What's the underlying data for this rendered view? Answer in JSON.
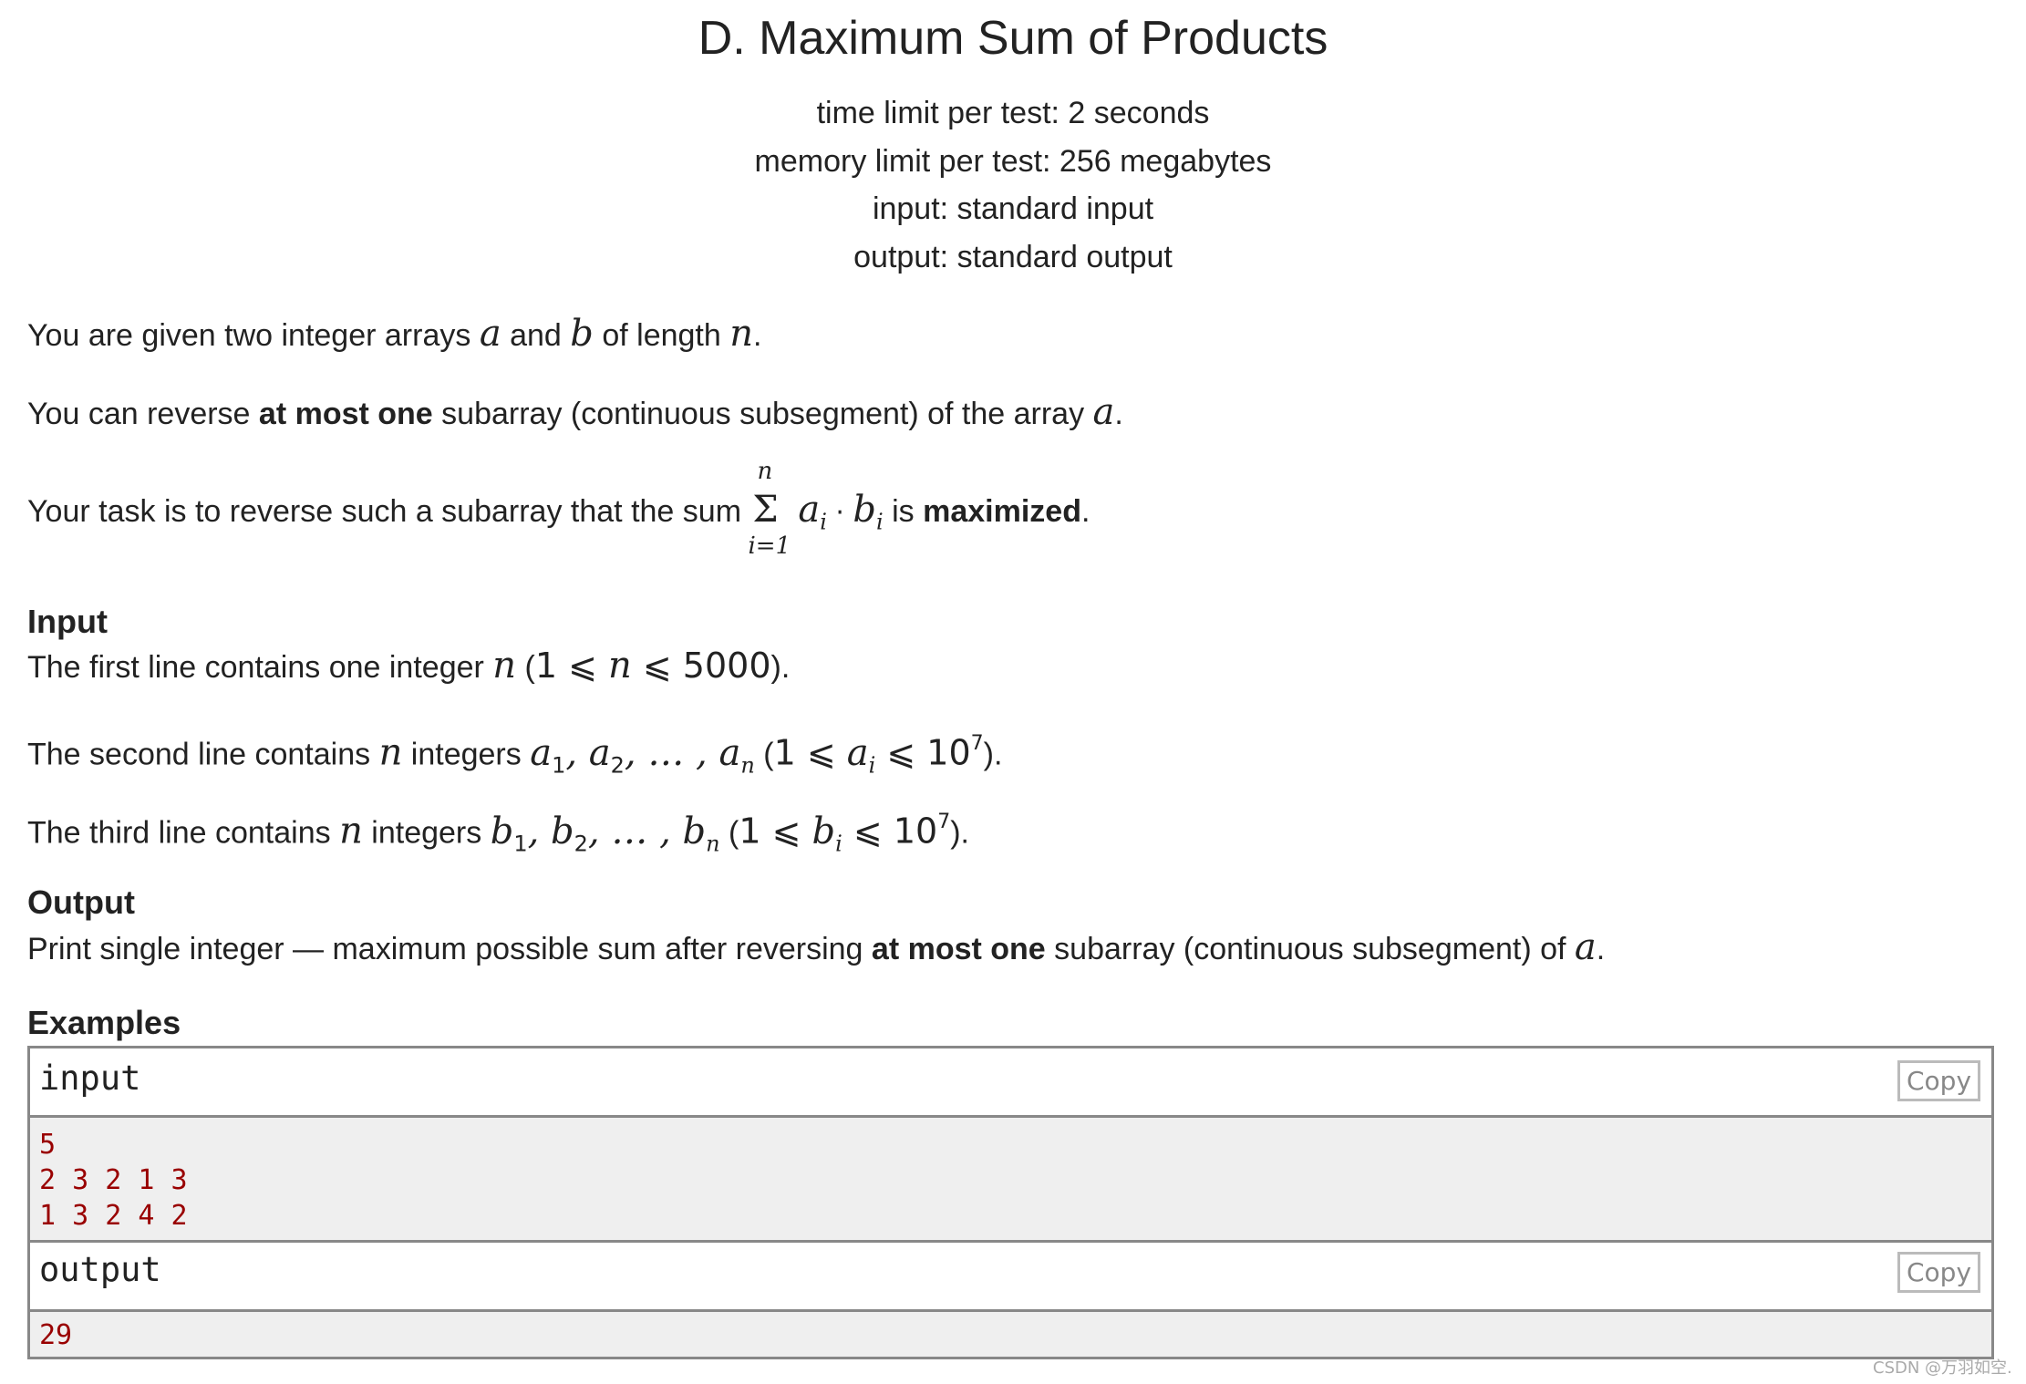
{
  "problem": {
    "title": "D. Maximum Sum of Products",
    "meta": [
      "time limit per test: 2 seconds",
      "memory limit per test: 256 megabytes",
      "input: standard input",
      "output: standard output"
    ]
  },
  "statement": {
    "p1": {
      "t1": "You are given two integer arrays ",
      "v1": "a",
      "t2": " and ",
      "v2": "b",
      "t3": " of length ",
      "v3": "n",
      "t4": "."
    },
    "p2": {
      "t1": "You can reverse ",
      "bold": "at most one",
      "t2": " subarray (continuous subsegment) of the array ",
      "v1": "a",
      "t3": "."
    },
    "p3": {
      "t1": "Your task is to reverse such a subarray that the sum ",
      "sigma": "Σ",
      "upper": "n",
      "lower": "i=1",
      "term_a": "a",
      "term_a_sub": "i",
      "dot": "·",
      "term_b": "b",
      "term_b_sub": "i",
      "t2": " is ",
      "bold": "maximized",
      "t3": "."
    }
  },
  "input_section": {
    "heading": "Input",
    "line1": {
      "t1": "The first line contains one integer ",
      "v1": "n",
      "t2": " (",
      "c1": "1 ⩽ ",
      "v2": "n",
      "c2": " ⩽ 5000",
      "t3": ")."
    },
    "line2": {
      "t1": "The second line contains ",
      "v1": "n",
      "t2": " integers ",
      "seq": [
        "a",
        "1",
        ", a",
        "2",
        ", … , a",
        "n"
      ],
      "t3": " (",
      "c1": "1 ⩽ ",
      "v2": "a",
      "v2_sub": "i",
      "c2": " ⩽ 10",
      "exp": "7",
      "t4": ")."
    },
    "line3": {
      "t1": "The third line contains ",
      "v1": "n",
      "t2": " integers ",
      "seq": [
        "b",
        "1",
        ", b",
        "2",
        ", … , b",
        "n"
      ],
      "t3": " (",
      "c1": "1 ⩽ ",
      "v2": "b",
      "v2_sub": "i",
      "c2": " ⩽ 10",
      "exp": "7",
      "t4": ")."
    }
  },
  "output_section": {
    "heading": "Output",
    "line": {
      "t1": "Print single integer — maximum possible sum after reversing ",
      "bold": "at most one",
      "t2": " subarray (continuous subsegment) of ",
      "v1": "a",
      "t3": "."
    }
  },
  "examples": {
    "heading": "Examples",
    "input": {
      "label": "input",
      "copy_label": "Copy",
      "lines": [
        "5",
        "2 3 2 1 3",
        "1 3 2 4 2"
      ]
    },
    "output": {
      "label": "output",
      "copy_label": "Copy",
      "lines": [
        "29"
      ]
    }
  },
  "watermark": "CSDN @万羽如空.",
  "colors": {
    "text": "#222222",
    "sample_text": "#990000",
    "sample_bg": "#efefef",
    "border": "#888888",
    "copy_border": "#bbbbbb",
    "copy_text": "#888888"
  }
}
